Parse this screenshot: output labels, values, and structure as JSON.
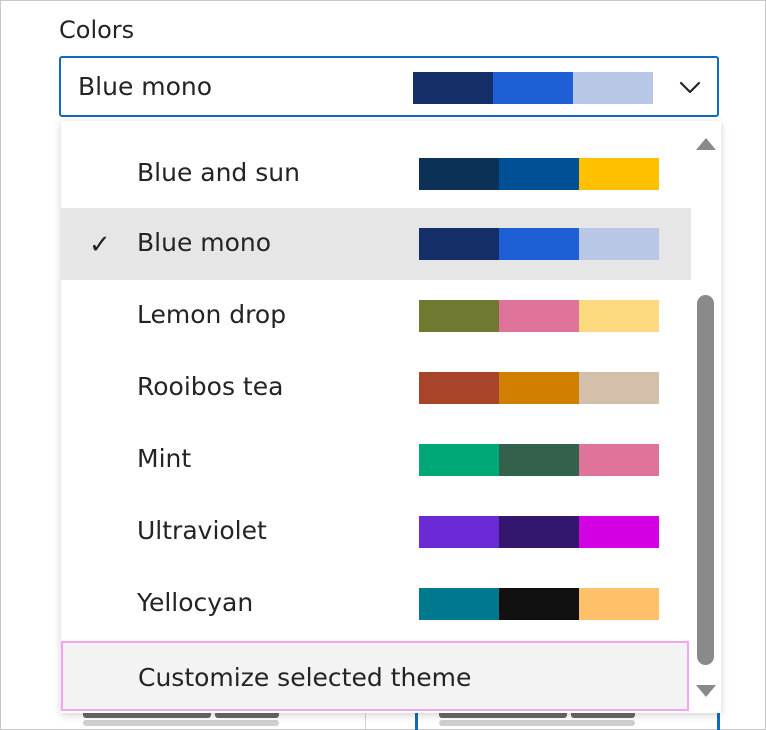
{
  "colors_label": "Colors",
  "combo": {
    "value": "Blue mono",
    "swatches": [
      "#142e68",
      "#1f5fd6",
      "#b8c7e6"
    ],
    "chevron_icon": "chevron-down-icon"
  },
  "options": [
    {
      "label": "Blue and sun",
      "selected": false,
      "swatches": [
        "#0b3157",
        "#005096",
        "#ffc000"
      ]
    },
    {
      "label": "Blue mono",
      "selected": true,
      "swatches": [
        "#142e68",
        "#1f5fd6",
        "#b8c7e6"
      ]
    },
    {
      "label": "Lemon drop",
      "selected": false,
      "swatches": [
        "#71782f",
        "#e07399",
        "#fdda80"
      ]
    },
    {
      "label": "Rooibos tea",
      "selected": false,
      "swatches": [
        "#a8442a",
        "#d07f00",
        "#d4c0aa"
      ]
    },
    {
      "label": "Mint",
      "selected": false,
      "swatches": [
        "#00a878",
        "#33614c",
        "#e07399"
      ]
    },
    {
      "label": "Ultraviolet",
      "selected": false,
      "swatches": [
        "#6b2ad6",
        "#33166e",
        "#d400e4"
      ]
    },
    {
      "label": "Yellocyan",
      "selected": false,
      "swatches": [
        "#00788e",
        "#111111",
        "#fec068"
      ]
    }
  ],
  "selected_check": "✓",
  "customize": {
    "label": "Customize selected theme"
  }
}
